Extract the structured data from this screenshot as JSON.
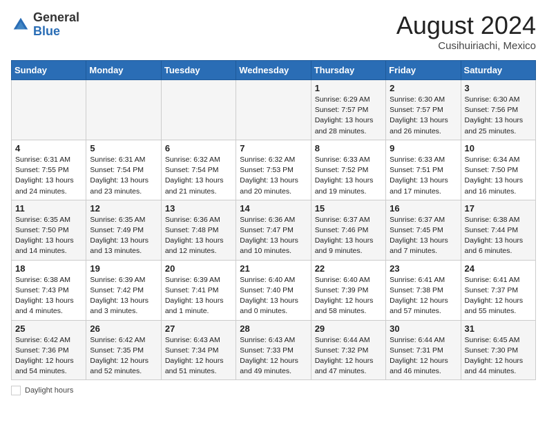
{
  "header": {
    "logo_general": "General",
    "logo_blue": "Blue",
    "month_year": "August 2024",
    "location": "Cusihuiriachi, Mexico"
  },
  "days_of_week": [
    "Sunday",
    "Monday",
    "Tuesday",
    "Wednesday",
    "Thursday",
    "Friday",
    "Saturday"
  ],
  "weeks": [
    [
      {
        "day": "",
        "info": ""
      },
      {
        "day": "",
        "info": ""
      },
      {
        "day": "",
        "info": ""
      },
      {
        "day": "",
        "info": ""
      },
      {
        "day": "1",
        "info": "Sunrise: 6:29 AM\nSunset: 7:57 PM\nDaylight: 13 hours\nand 28 minutes."
      },
      {
        "day": "2",
        "info": "Sunrise: 6:30 AM\nSunset: 7:57 PM\nDaylight: 13 hours\nand 26 minutes."
      },
      {
        "day": "3",
        "info": "Sunrise: 6:30 AM\nSunset: 7:56 PM\nDaylight: 13 hours\nand 25 minutes."
      }
    ],
    [
      {
        "day": "4",
        "info": "Sunrise: 6:31 AM\nSunset: 7:55 PM\nDaylight: 13 hours\nand 24 minutes."
      },
      {
        "day": "5",
        "info": "Sunrise: 6:31 AM\nSunset: 7:54 PM\nDaylight: 13 hours\nand 23 minutes."
      },
      {
        "day": "6",
        "info": "Sunrise: 6:32 AM\nSunset: 7:54 PM\nDaylight: 13 hours\nand 21 minutes."
      },
      {
        "day": "7",
        "info": "Sunrise: 6:32 AM\nSunset: 7:53 PM\nDaylight: 13 hours\nand 20 minutes."
      },
      {
        "day": "8",
        "info": "Sunrise: 6:33 AM\nSunset: 7:52 PM\nDaylight: 13 hours\nand 19 minutes."
      },
      {
        "day": "9",
        "info": "Sunrise: 6:33 AM\nSunset: 7:51 PM\nDaylight: 13 hours\nand 17 minutes."
      },
      {
        "day": "10",
        "info": "Sunrise: 6:34 AM\nSunset: 7:50 PM\nDaylight: 13 hours\nand 16 minutes."
      }
    ],
    [
      {
        "day": "11",
        "info": "Sunrise: 6:35 AM\nSunset: 7:50 PM\nDaylight: 13 hours\nand 14 minutes."
      },
      {
        "day": "12",
        "info": "Sunrise: 6:35 AM\nSunset: 7:49 PM\nDaylight: 13 hours\nand 13 minutes."
      },
      {
        "day": "13",
        "info": "Sunrise: 6:36 AM\nSunset: 7:48 PM\nDaylight: 13 hours\nand 12 minutes."
      },
      {
        "day": "14",
        "info": "Sunrise: 6:36 AM\nSunset: 7:47 PM\nDaylight: 13 hours\nand 10 minutes."
      },
      {
        "day": "15",
        "info": "Sunrise: 6:37 AM\nSunset: 7:46 PM\nDaylight: 13 hours\nand 9 minutes."
      },
      {
        "day": "16",
        "info": "Sunrise: 6:37 AM\nSunset: 7:45 PM\nDaylight: 13 hours\nand 7 minutes."
      },
      {
        "day": "17",
        "info": "Sunrise: 6:38 AM\nSunset: 7:44 PM\nDaylight: 13 hours\nand 6 minutes."
      }
    ],
    [
      {
        "day": "18",
        "info": "Sunrise: 6:38 AM\nSunset: 7:43 PM\nDaylight: 13 hours\nand 4 minutes."
      },
      {
        "day": "19",
        "info": "Sunrise: 6:39 AM\nSunset: 7:42 PM\nDaylight: 13 hours\nand 3 minutes."
      },
      {
        "day": "20",
        "info": "Sunrise: 6:39 AM\nSunset: 7:41 PM\nDaylight: 13 hours\nand 1 minute."
      },
      {
        "day": "21",
        "info": "Sunrise: 6:40 AM\nSunset: 7:40 PM\nDaylight: 13 hours\nand 0 minutes."
      },
      {
        "day": "22",
        "info": "Sunrise: 6:40 AM\nSunset: 7:39 PM\nDaylight: 12 hours\nand 58 minutes."
      },
      {
        "day": "23",
        "info": "Sunrise: 6:41 AM\nSunset: 7:38 PM\nDaylight: 12 hours\nand 57 minutes."
      },
      {
        "day": "24",
        "info": "Sunrise: 6:41 AM\nSunset: 7:37 PM\nDaylight: 12 hours\nand 55 minutes."
      }
    ],
    [
      {
        "day": "25",
        "info": "Sunrise: 6:42 AM\nSunset: 7:36 PM\nDaylight: 12 hours\nand 54 minutes."
      },
      {
        "day": "26",
        "info": "Sunrise: 6:42 AM\nSunset: 7:35 PM\nDaylight: 12 hours\nand 52 minutes."
      },
      {
        "day": "27",
        "info": "Sunrise: 6:43 AM\nSunset: 7:34 PM\nDaylight: 12 hours\nand 51 minutes."
      },
      {
        "day": "28",
        "info": "Sunrise: 6:43 AM\nSunset: 7:33 PM\nDaylight: 12 hours\nand 49 minutes."
      },
      {
        "day": "29",
        "info": "Sunrise: 6:44 AM\nSunset: 7:32 PM\nDaylight: 12 hours\nand 47 minutes."
      },
      {
        "day": "30",
        "info": "Sunrise: 6:44 AM\nSunset: 7:31 PM\nDaylight: 12 hours\nand 46 minutes."
      },
      {
        "day": "31",
        "info": "Sunrise: 6:45 AM\nSunset: 7:30 PM\nDaylight: 12 hours\nand 44 minutes."
      }
    ]
  ],
  "footer": {
    "daylight_label": "Daylight hours"
  }
}
